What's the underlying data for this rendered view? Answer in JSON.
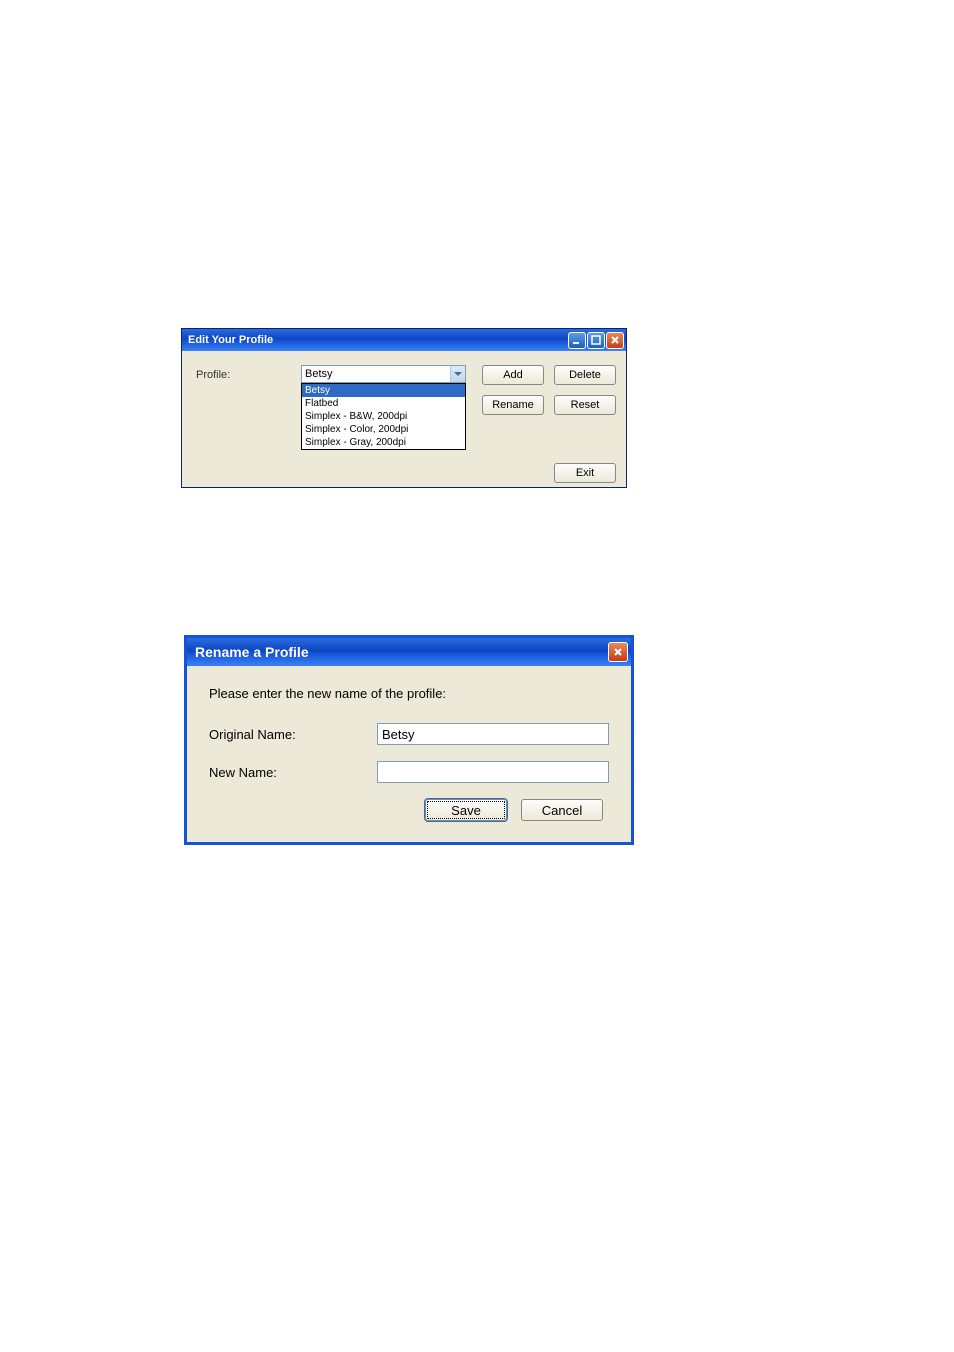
{
  "window1": {
    "title": "Edit Your Profile",
    "profile_label": "Profile:",
    "selected_profile": "Betsy",
    "options": [
      "Betsy",
      "Flatbed",
      "Simplex - B&W, 200dpi",
      "Simplex - Color, 200dpi",
      "Simplex - Gray, 200dpi"
    ],
    "buttons": {
      "add": "Add",
      "delete": "Delete",
      "rename": "Rename",
      "reset": "Reset",
      "exit": "Exit"
    }
  },
  "window2": {
    "title": "Rename a Profile",
    "prompt": "Please enter the new name of the profile:",
    "original_name_label": "Original Name:",
    "original_name_value": "Betsy",
    "new_name_label": "New Name:",
    "new_name_value": "",
    "buttons": {
      "save": "Save",
      "cancel": "Cancel"
    }
  }
}
